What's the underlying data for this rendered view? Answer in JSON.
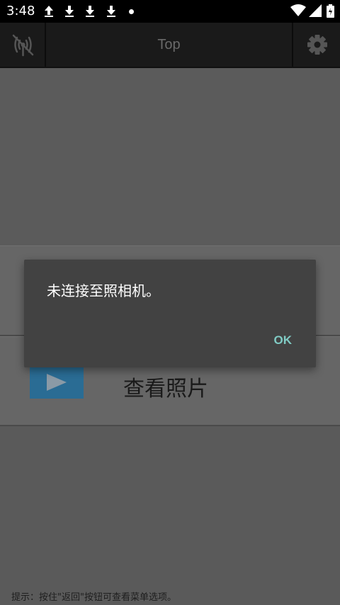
{
  "status_bar": {
    "time": "3:48"
  },
  "app_bar": {
    "title": "Top",
    "left_icon": "no-signal-icon",
    "right_icon": "gear-icon"
  },
  "content": {
    "card2_label": "查看照片"
  },
  "hint": "提示：按住\"返回\"按钮可查看菜单选项。",
  "dialog": {
    "message": "未连接至照相机。",
    "ok_label": "OK"
  },
  "colors": {
    "dialog_bg": "#424242",
    "ok_accent": "#80cbc4",
    "thumb": "#2a6c94"
  }
}
